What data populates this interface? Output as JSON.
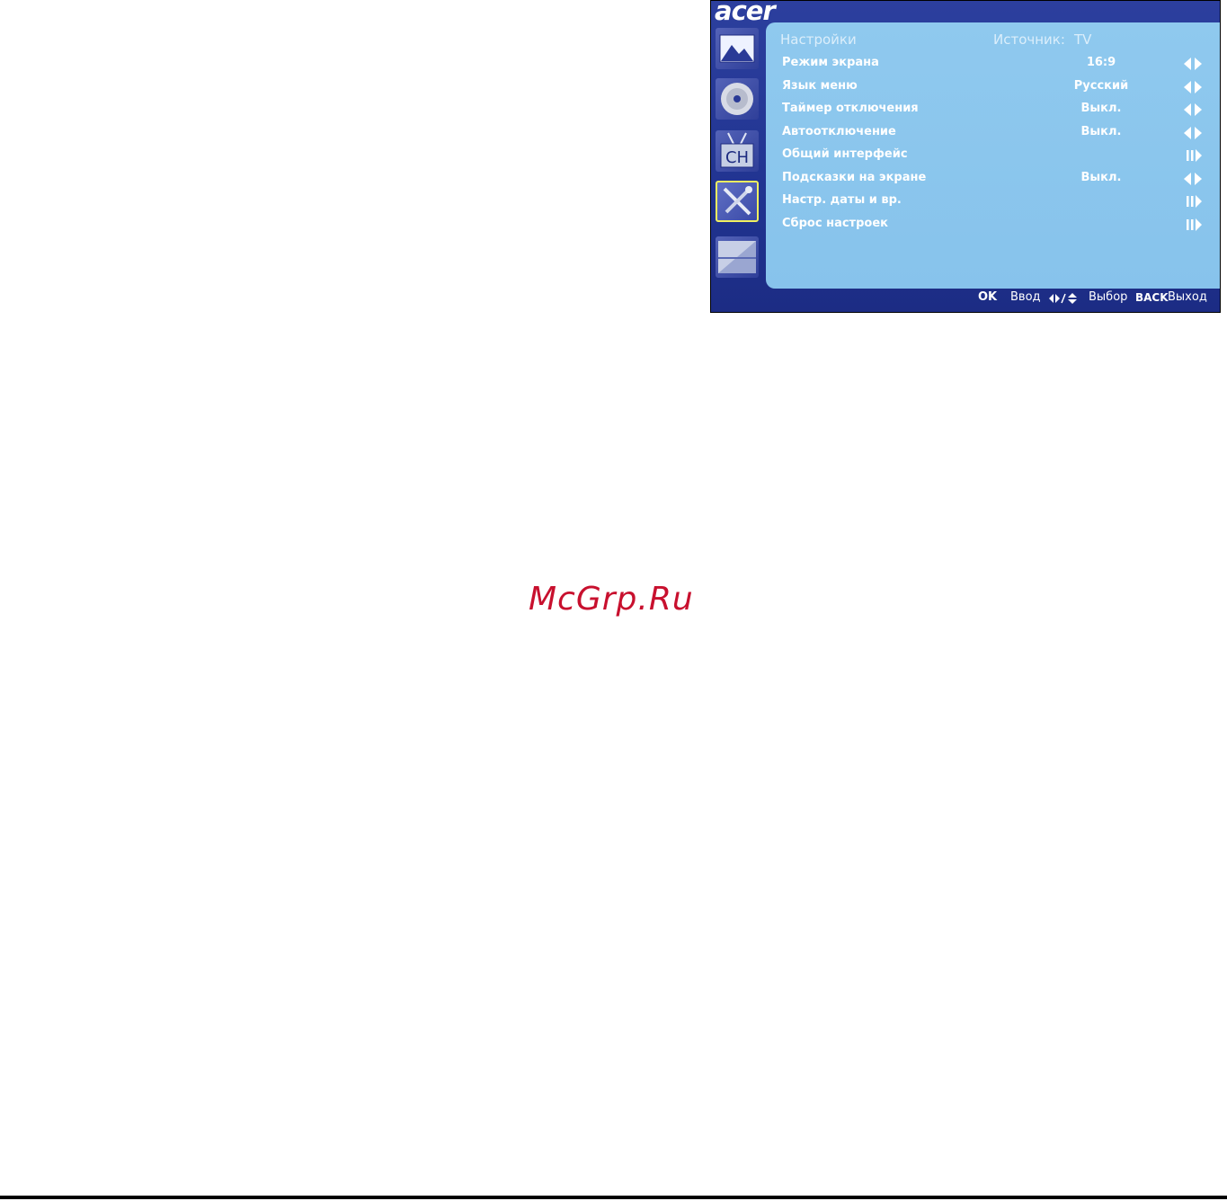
{
  "brand": {
    "logo_text": "acer"
  },
  "sidebar": {
    "items": [
      {
        "name": "picture",
        "icon": "picture-icon",
        "active": false
      },
      {
        "name": "audio",
        "icon": "disc-icon",
        "active": false
      },
      {
        "name": "channel",
        "icon": "channel-icon",
        "label": "CH",
        "active": false
      },
      {
        "name": "settings",
        "icon": "tools-icon",
        "active": true
      },
      {
        "name": "other",
        "icon": "panel-icon",
        "active": false
      }
    ]
  },
  "panel": {
    "title": "Настройки",
    "source_label": "Источник:",
    "source_value": "TV",
    "rows": [
      {
        "label": "Режим экрана",
        "value": "16:9",
        "arrow": "left-right"
      },
      {
        "label": "Язык меню",
        "value": "Русский",
        "arrow": "left-right"
      },
      {
        "label": "Таймер отключения",
        "value": "Выкл.",
        "arrow": "left-right"
      },
      {
        "label": "Автоотключение",
        "value": "Выкл.",
        "arrow": "left-right"
      },
      {
        "label": "Общий интерфейс",
        "value": "",
        "arrow": "enter"
      },
      {
        "label": "Подсказки на экране",
        "value": "Выкл.",
        "arrow": "left-right"
      },
      {
        "label": "Настр. даты и вр.",
        "value": "",
        "arrow": "enter"
      },
      {
        "label": "Сброс настроек",
        "value": "",
        "arrow": "enter"
      }
    ]
  },
  "footer": {
    "ok_key": "OK",
    "ok_action": "Ввод",
    "nav_action": "Выбор",
    "back_key": "BACK",
    "back_action": "Выход"
  },
  "watermark": "McGrp.Ru",
  "colors": {
    "osd_frame": "#213491",
    "panel_bg": "#8fc9ee",
    "active_border": "#f0f060",
    "watermark": "#c8102e"
  }
}
